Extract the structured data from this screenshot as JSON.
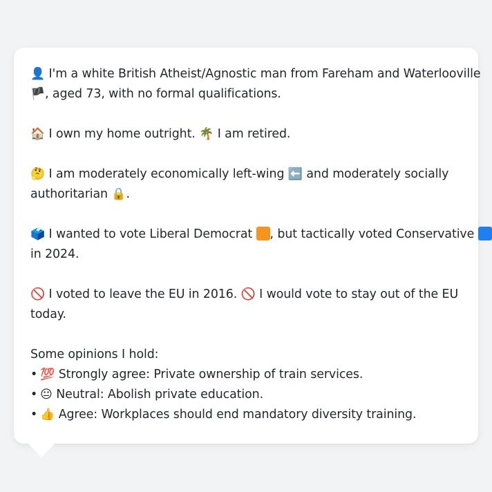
{
  "profile": {
    "p1": {
      "icon1": "👤",
      "line1": "I'm a white British Atheist/Agnostic man from Fareham and Waterlooville",
      "icon2": "🏴",
      "line2": ", aged 73, with no formal qualifications."
    },
    "p2": {
      "icon1": "🏠",
      "text1": "I own my home outright.",
      "icon2": "🌴",
      "text2": "I am retired."
    },
    "p3": {
      "icon1": "🤔",
      "text1": "I am moderately economically left-wing",
      "icon2": "⬅️",
      "text2": "and moderately socially",
      "line2": "authoritarian",
      "icon3": "🔒",
      "tail": "."
    },
    "p4": {
      "icon1": "🗳️",
      "text1": "I wanted to vote Liberal Democrat",
      "color1": "#f7941d",
      "text2": ", but tactically voted Conservative",
      "color2": "#1e7ff0",
      "line2": "in 2024."
    },
    "p5": {
      "icon1": "🚫",
      "text1": "I voted to leave the EU in 2016.",
      "icon2": "🚫",
      "text2": "I would vote to stay out of the EU",
      "line2": "today."
    },
    "opinions": {
      "heading": "Some opinions I hold:",
      "bullet": "•",
      "items": [
        {
          "icon": "💯",
          "text": "Strongly agree: Private ownership of train services."
        },
        {
          "icon": "😐",
          "text": "Neutral: Abolish private education."
        },
        {
          "icon": "👍",
          "text": "Agree: Workplaces should end mandatory diversity training."
        }
      ]
    }
  }
}
